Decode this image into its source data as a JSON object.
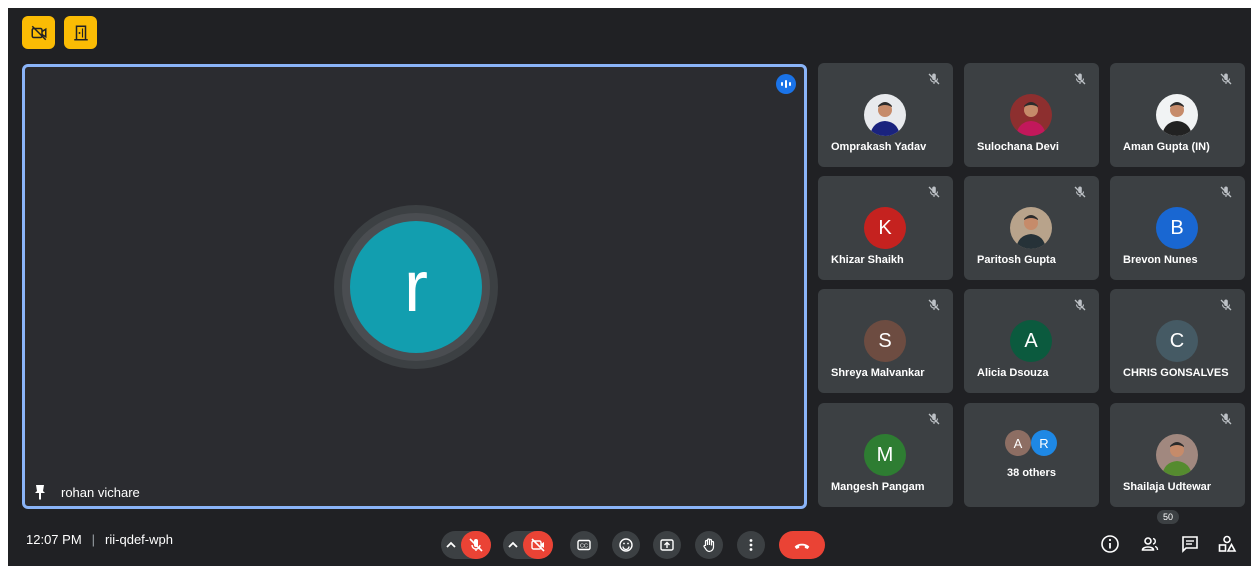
{
  "colors": {
    "accent": "#8ab4f8",
    "end_call": "#ea4335",
    "warning": "#fbbc04"
  },
  "top_buttons": [
    {
      "icon": "no-video-icon"
    },
    {
      "icon": "door-icon"
    }
  ],
  "main_tile": {
    "avatar_letter": "r",
    "name": "rohan vichare",
    "icons": [
      "pin-icon",
      "speaking-indicator-icon"
    ]
  },
  "participants": [
    {
      "name": "Omprakash Yadav",
      "letter": "",
      "avatar": "photo",
      "muted": true
    },
    {
      "name": "Sulochana Devi",
      "letter": "",
      "avatar": "photo",
      "muted": true
    },
    {
      "name": "Aman Gupta (IN)",
      "letter": "",
      "avatar": "photo",
      "muted": true
    },
    {
      "name": "Khizar Shaikh",
      "letter": "K",
      "color": "#c5221f",
      "muted": true
    },
    {
      "name": "Paritosh Gupta",
      "letter": "",
      "avatar": "photo",
      "muted": true
    },
    {
      "name": "Brevon Nunes",
      "letter": "B",
      "color": "#1967d2",
      "muted": true
    },
    {
      "name": "Shreya Malvankar",
      "letter": "S",
      "color": "#6d4c41",
      "muted": true
    },
    {
      "name": "Alicia Dsouza",
      "letter": "A",
      "color": "#0b5a3e",
      "muted": true
    },
    {
      "name": "CHRIS GONSALVES",
      "letter": "C",
      "color": "#455a64",
      "muted": true
    },
    {
      "name": "Mangesh Pangam",
      "letter": "M",
      "color": "#2e7d32",
      "muted": true
    },
    {
      "name": "Shailaja Udtewar",
      "letter": "",
      "avatar": "photo",
      "muted": true
    }
  ],
  "others_tile": {
    "label": "38 others",
    "letters": [
      "A",
      "R"
    ]
  },
  "footer": {
    "time": "12:07 PM",
    "separator": "|",
    "meeting_code": "rii-qdef-wph",
    "people_count": "50",
    "controls": [
      "microphone-options",
      "microphone-off",
      "camera-options",
      "camera-off",
      "captions",
      "emoji-reactions",
      "present-screen",
      "raise-hand",
      "more-options",
      "leave-call"
    ],
    "right_icons": [
      "info-icon",
      "people-icon",
      "chat-icon",
      "activities-icon"
    ]
  }
}
